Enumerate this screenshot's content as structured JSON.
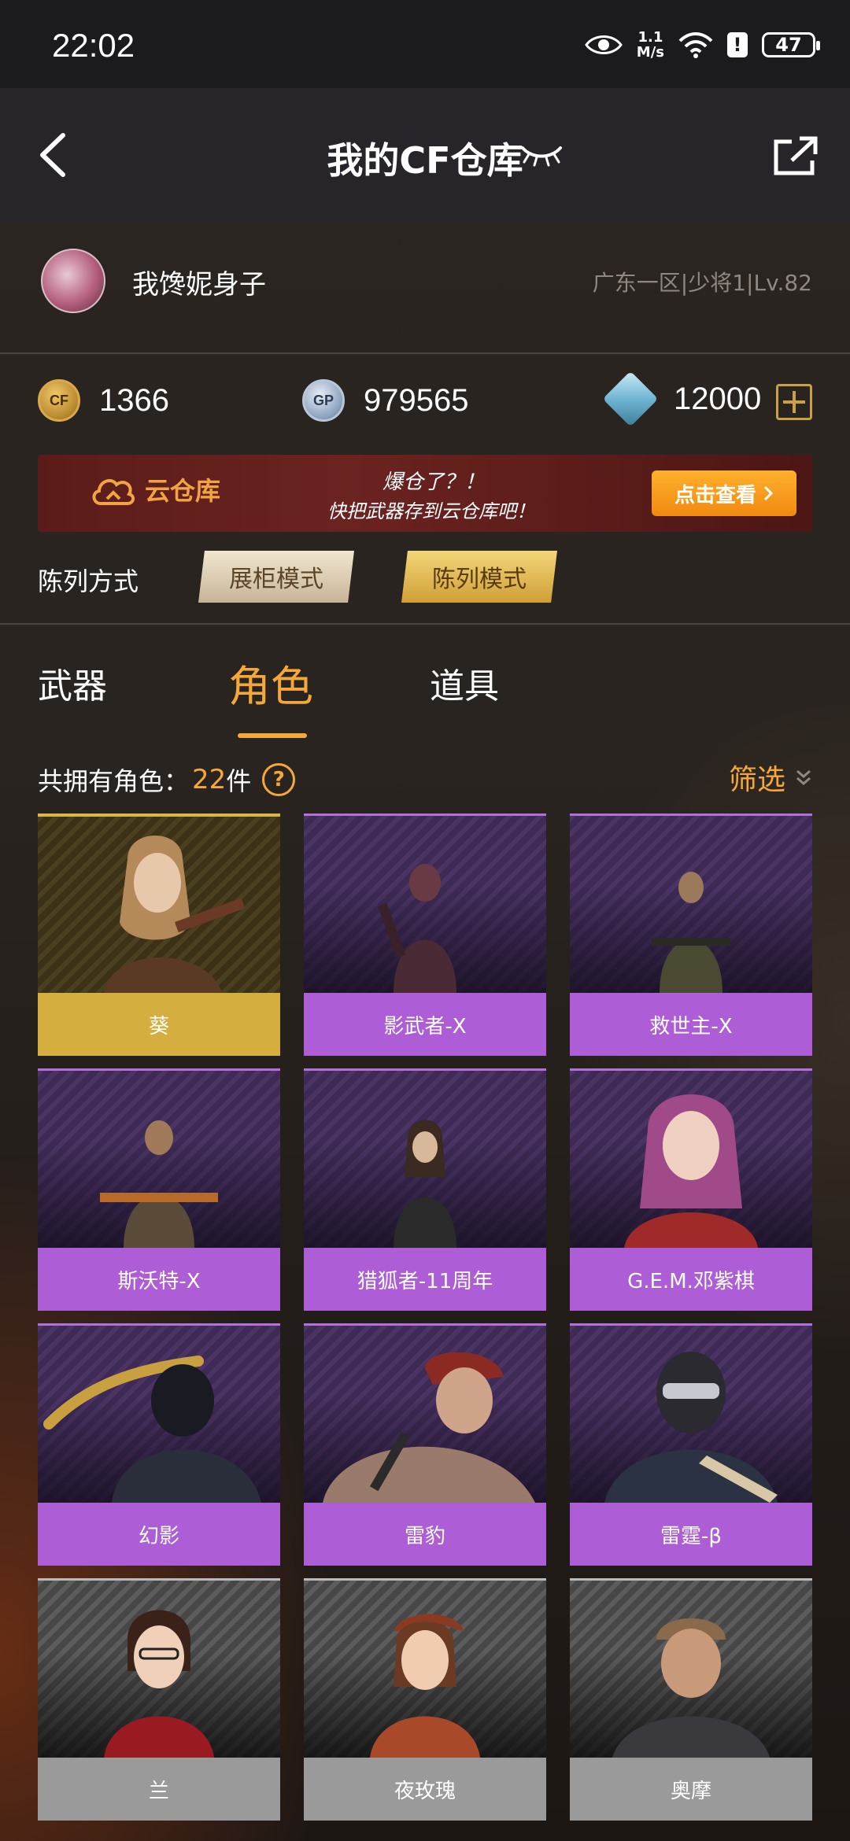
{
  "status_bar": {
    "time": "22:02",
    "speed_value": "1.1",
    "speed_unit": "M/s",
    "battery": "47"
  },
  "header": {
    "title": "我的CF仓库"
  },
  "profile": {
    "nickname": "我馋妮身子",
    "server_info": "广东一区|少将1|Lv.82"
  },
  "currency": {
    "cf_points": "1366",
    "gp": "979565",
    "diamonds": "12000"
  },
  "banner": {
    "title": "云仓库",
    "slogan_line1": "爆仓了？！",
    "slogan_line2": "快把武器存到云仓库吧！",
    "button": "点击查看"
  },
  "display_mode": {
    "label": "陈列方式",
    "options": [
      "展柜模式",
      "陈列模式"
    ],
    "selected": "陈列模式"
  },
  "tabs": [
    {
      "label": "武器"
    },
    {
      "label": "角色",
      "active": true
    },
    {
      "label": "道具"
    }
  ],
  "summary": {
    "prefix": "共拥有角色：",
    "count": "22",
    "unit": "件",
    "filter_label": "筛选"
  },
  "characters": [
    {
      "name": "葵",
      "rarity": "gold"
    },
    {
      "name": "影武者-X",
      "rarity": "purple"
    },
    {
      "name": "救世主-X",
      "rarity": "purple"
    },
    {
      "name": "斯沃特-X",
      "rarity": "purple"
    },
    {
      "name": "猎狐者-11周年",
      "rarity": "purple"
    },
    {
      "name": "G.E.M.邓紫棋",
      "rarity": "purple"
    },
    {
      "name": "幻影",
      "rarity": "purple"
    },
    {
      "name": "雷豹",
      "rarity": "purple"
    },
    {
      "name": "雷霆-β",
      "rarity": "purple"
    },
    {
      "name": "兰",
      "rarity": "gray"
    },
    {
      "name": "夜玫瑰",
      "rarity": "gray"
    },
    {
      "name": "奥摩",
      "rarity": "gray"
    }
  ],
  "colors": {
    "accent": "#f4a83a",
    "gold": "#d4ae3e",
    "purple": "#ad5ed6",
    "gray": "#9a9a9a"
  }
}
